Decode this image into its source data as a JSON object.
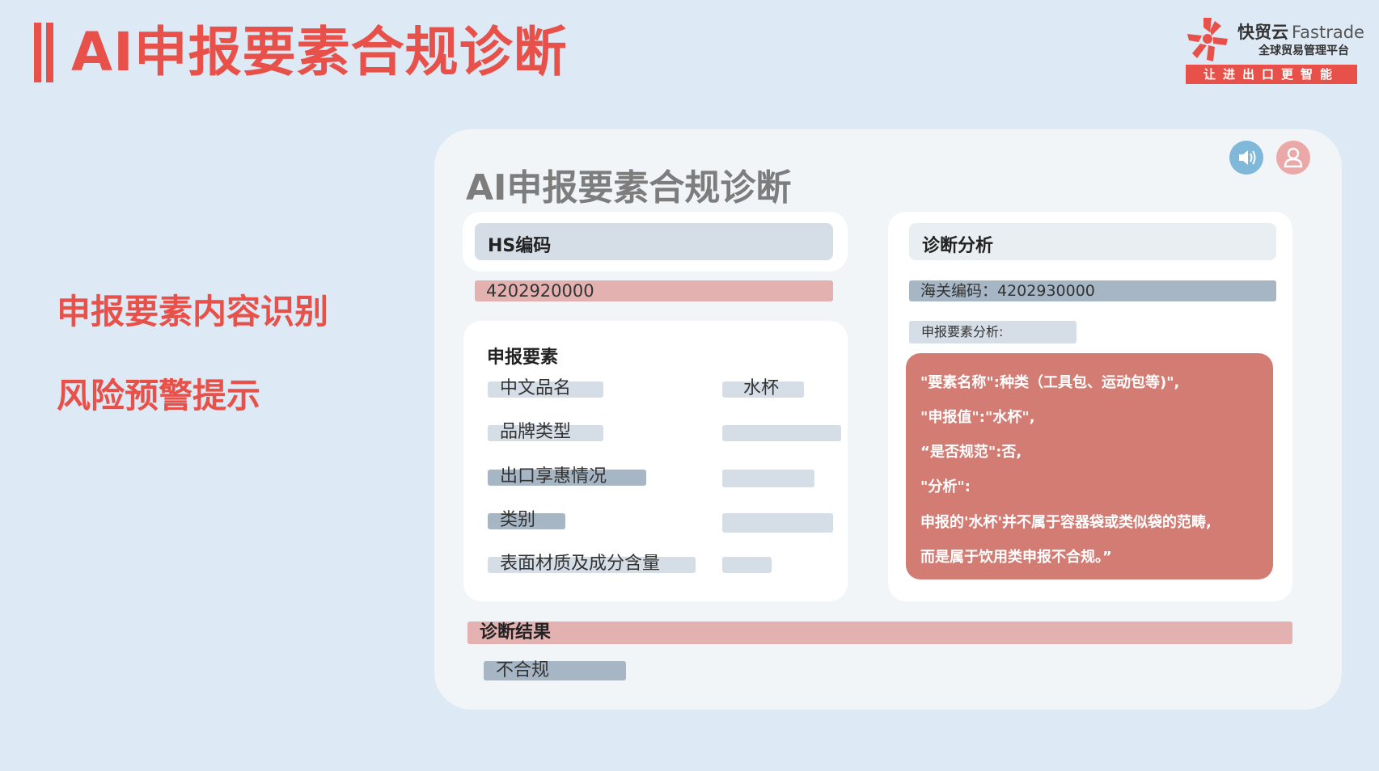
{
  "header": {
    "title": "AI申报要素合规诊断"
  },
  "logo": {
    "name": "快贸云",
    "name_en": "Fastrade",
    "subtitle": "全球贸易管理平台",
    "slogan": "让进出口更智能"
  },
  "features": [
    "申报要素内容识别",
    "风险预警提示"
  ],
  "panel": {
    "title": "AI申报要素合规诊断",
    "hs_label": "HS编码",
    "hs_value": "4202920000",
    "elements_title": "申报要素",
    "elements": [
      {
        "name": "中文品名",
        "value": "水杯"
      },
      {
        "name": "品牌类型",
        "value": ""
      },
      {
        "name": "出口享惠情况",
        "value": ""
      },
      {
        "name": "类别",
        "value": ""
      },
      {
        "name": "表面材质及成分含量",
        "value": ""
      }
    ],
    "diagnosis_title": "诊断分析",
    "customs_code": "海关编码：4202930000",
    "analysis_label": "申报要素分析:",
    "analysis_lines": [
      "\"要素名称\":种类（工具包、运动包等)\",",
      "\"申报值\":\"水杯\",",
      "“是否规范\":否,",
      "\"分析\":",
      "申报的'水杯'并不属于容器袋或类似袋的范畴,",
      "而是属于饮用类申报不合规。”"
    ],
    "result_label": "诊断结果",
    "result_value": "不合规"
  },
  "colors": {
    "accent": "#e8514a",
    "pink_bar": "#e4b1b1",
    "grey_blue_bar": "#a6b6c4",
    "light_bar": "#d5dde6",
    "analysis_box": "#d27c74",
    "speaker_btn": "#7fb8d8",
    "user_btn": "#eba8a8"
  },
  "icons": {
    "speaker": "speaker-icon",
    "user": "user-icon",
    "logo": "fastrade-logo-icon"
  }
}
